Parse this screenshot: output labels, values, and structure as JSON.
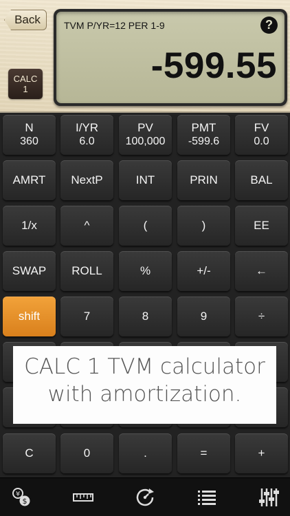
{
  "header": {
    "back_label": "Back",
    "badge_line1": "CALC",
    "badge_line2": "1"
  },
  "display": {
    "status": "TVM P/YR=12 PER 1-9",
    "help": "?",
    "value": "-599.55"
  },
  "keys": {
    "row1": [
      {
        "top": "N",
        "bottom": "360"
      },
      {
        "top": "I/YR",
        "bottom": "6.0"
      },
      {
        "top": "PV",
        "bottom": "100,000"
      },
      {
        "top": "PMT",
        "bottom": "-599.6"
      },
      {
        "top": "FV",
        "bottom": "0.0"
      }
    ],
    "row2": [
      "AMRT",
      "NextP",
      "INT",
      "PRIN",
      "BAL"
    ],
    "row3": [
      "1/x",
      "^",
      "(",
      ")",
      "EE"
    ],
    "row4": [
      "SWAP",
      "ROLL",
      "%",
      "+/-",
      "←"
    ],
    "row5": [
      "shift",
      "7",
      "8",
      "9",
      "÷"
    ],
    "row8": [
      "C",
      "0",
      ".",
      "=",
      "+"
    ]
  },
  "promo": {
    "line1": "CALC 1 TVM calculator",
    "line2": "with amortization."
  },
  "toolbar": {
    "icons": [
      "currency-icon",
      "ruler-icon",
      "speed-history-icon",
      "list-icon",
      "sliders-icon"
    ]
  },
  "colors": {
    "shift_key": "#e39027",
    "lcd": "#c3c3a6"
  }
}
